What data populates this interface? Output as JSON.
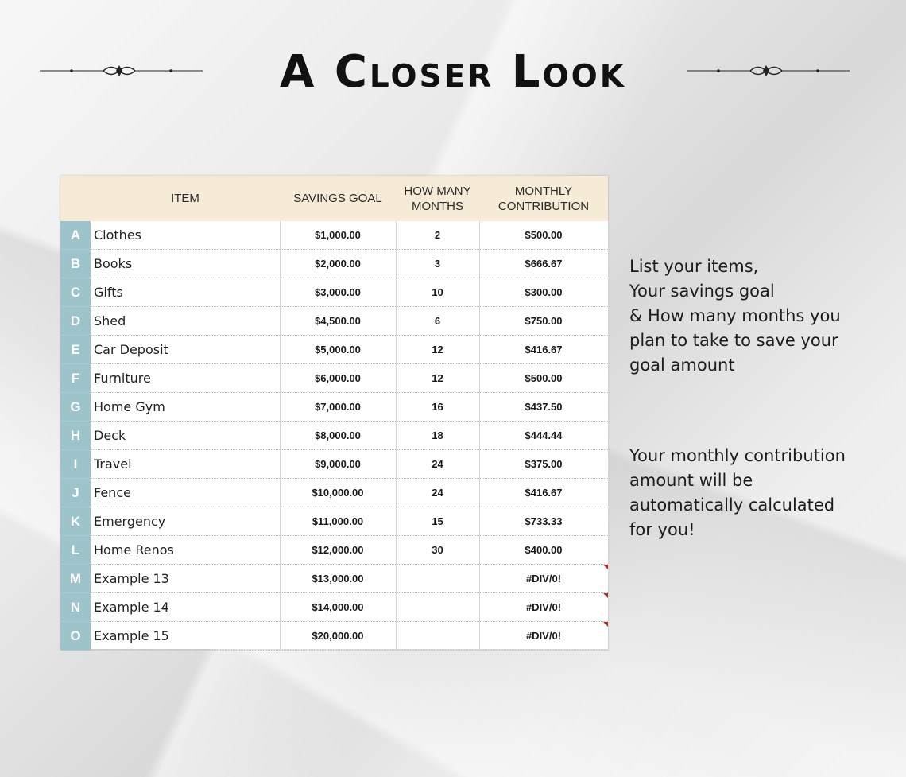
{
  "title": "A Closer Look",
  "table": {
    "headers": {
      "item": "ITEM",
      "savings_goal": "SAVINGS GOAL",
      "how_many_months_line1": "HOW MANY",
      "how_many_months_line2": "MONTHS",
      "monthly_contribution_line1": "MONTHLY",
      "monthly_contribution_line2": "CONTRIBUTION"
    },
    "rows": [
      {
        "letter": "A",
        "item": "Clothes",
        "goal": "$1,000.00",
        "months": "2",
        "monthly": "$500.00"
      },
      {
        "letter": "B",
        "item": "Books",
        "goal": "$2,000.00",
        "months": "3",
        "monthly": "$666.67"
      },
      {
        "letter": "C",
        "item": "Gifts",
        "goal": "$3,000.00",
        "months": "10",
        "monthly": "$300.00"
      },
      {
        "letter": "D",
        "item": "Shed",
        "goal": "$4,500.00",
        "months": "6",
        "monthly": "$750.00"
      },
      {
        "letter": "E",
        "item": "Car Deposit",
        "goal": "$5,000.00",
        "months": "12",
        "monthly": "$416.67"
      },
      {
        "letter": "F",
        "item": "Furniture",
        "goal": "$6,000.00",
        "months": "12",
        "monthly": "$500.00"
      },
      {
        "letter": "G",
        "item": "Home Gym",
        "goal": "$7,000.00",
        "months": "16",
        "monthly": "$437.50"
      },
      {
        "letter": "H",
        "item": "Deck",
        "goal": "$8,000.00",
        "months": "18",
        "monthly": "$444.44"
      },
      {
        "letter": "I",
        "item": "Travel",
        "goal": "$9,000.00",
        "months": "24",
        "monthly": "$375.00"
      },
      {
        "letter": "J",
        "item": "Fence",
        "goal": "$10,000.00",
        "months": "24",
        "monthly": "$416.67"
      },
      {
        "letter": "K",
        "item": "Emergency",
        "goal": "$11,000.00",
        "months": "15",
        "monthly": "$733.33"
      },
      {
        "letter": "L",
        "item": "Home Renos",
        "goal": "$12,000.00",
        "months": "30",
        "monthly": "$400.00"
      },
      {
        "letter": "M",
        "item": "Example 13",
        "goal": "$13,000.00",
        "months": "",
        "monthly": "#DIV/0!",
        "error": true
      },
      {
        "letter": "N",
        "item": "Example 14",
        "goal": "$14,000.00",
        "months": "",
        "monthly": "#DIV/0!",
        "error": true
      },
      {
        "letter": "O",
        "item": "Example 15",
        "goal": "$20,000.00",
        "months": "",
        "monthly": "#DIV/0!",
        "error": true
      }
    ]
  },
  "side_text_1": [
    "List your items,",
    "Your savings goal",
    "& How many months you",
    "plan to take to save your",
    "goal amount"
  ],
  "side_text_2": [
    "Your monthly contribution",
    "amount will be",
    "automatically calculated",
    "for you!"
  ],
  "colors": {
    "header_bg": "#f6ebd7",
    "letter_col_bg": "#9cc4ca",
    "error_flag": "#c0271d"
  }
}
